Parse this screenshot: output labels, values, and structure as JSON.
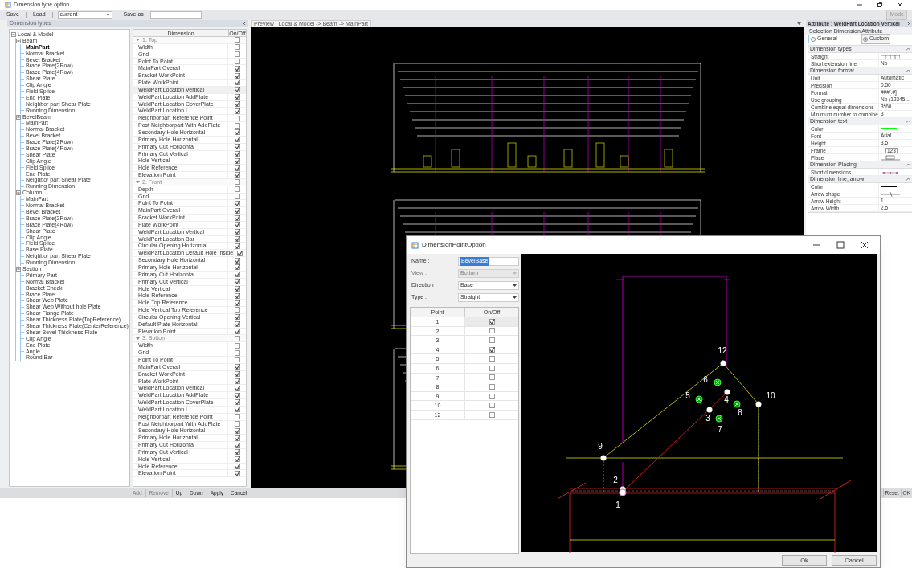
{
  "window": {
    "title": "Dimension type option"
  },
  "toolbar": {
    "save": "Save",
    "load": "Load",
    "preset": "current",
    "save_as": "Save as",
    "mode": "Mode"
  },
  "tree": {
    "title": "Dimension types",
    "root": {
      "label": "Local & Model",
      "expanded": true,
      "children": [
        {
          "label": "Beam",
          "expanded": true,
          "children": [
            {
              "label": "MainPart",
              "selected": true
            },
            {
              "label": "Normal Bracket",
              "selected": false
            },
            {
              "label": "Bevel Bracket",
              "selected": false
            },
            {
              "label": "Brace Plate(2Row)",
              "selected": false
            },
            {
              "label": "Brace Plate(4Row)",
              "selected": false
            },
            {
              "label": "Shear Plate",
              "selected": false
            },
            {
              "label": "Clip Angle",
              "selected": false
            },
            {
              "label": "Field Splice",
              "selected": false
            },
            {
              "label": "End Plate",
              "selected": false
            },
            {
              "label": "Neighbor part Shear Plate",
              "selected": false
            },
            {
              "label": "Running Dimension",
              "selected": false
            }
          ]
        },
        {
          "label": "BevelBeam",
          "expanded": true,
          "children": [
            {
              "label": "MainPart",
              "selected": false
            },
            {
              "label": "Normal Bracket",
              "selected": false
            },
            {
              "label": "Bevel Bracket",
              "selected": false
            },
            {
              "label": "Brace Plate(2Row)",
              "selected": false
            },
            {
              "label": "Brace Plate(4Row)",
              "selected": false
            },
            {
              "label": "Shear Plate",
              "selected": false
            },
            {
              "label": "Clip Angle",
              "selected": false
            },
            {
              "label": "Field Splice",
              "selected": false
            },
            {
              "label": "End Plate",
              "selected": false
            },
            {
              "label": "Neighbor part Shear Plate",
              "selected": false
            },
            {
              "label": "Running Dimension",
              "selected": false
            }
          ]
        },
        {
          "label": "Column",
          "expanded": true,
          "children": [
            {
              "label": "MainPart",
              "selected": false
            },
            {
              "label": "Normal Bracket",
              "selected": false
            },
            {
              "label": "Bevel Bracket",
              "selected": false
            },
            {
              "label": "Brace Plate(2Row)",
              "selected": false
            },
            {
              "label": "Brace Plate(4Row)",
              "selected": false
            },
            {
              "label": "Shear Plate",
              "selected": false
            },
            {
              "label": "Clip Angle",
              "selected": false
            },
            {
              "label": "Field Splice",
              "selected": false
            },
            {
              "label": "Base Plate",
              "selected": false
            },
            {
              "label": "Neighbor part Shear Plate",
              "selected": false
            },
            {
              "label": "Running Dimension",
              "selected": false
            }
          ]
        },
        {
          "label": "Section",
          "expanded": true,
          "children": [
            {
              "label": "Primary Part",
              "selected": false
            },
            {
              "label": "Normal Bracket",
              "selected": false
            },
            {
              "label": "Bracket Check",
              "selected": false
            },
            {
              "label": "Brace Plate",
              "selected": false
            },
            {
              "label": "Shear Web Plate",
              "selected": false
            },
            {
              "label": "Shear Web Without hole Plate",
              "selected": false
            },
            {
              "label": "Shear Flange Plate",
              "selected": false
            },
            {
              "label": "Shear Thickness Plate(TopReference)",
              "selected": false
            },
            {
              "label": "Shear Thickness Plate(CenterReference)",
              "selected": false
            },
            {
              "label": "Shear Bevel Thickness Plate",
              "selected": false
            },
            {
              "label": "Clip Angle",
              "selected": false
            },
            {
              "label": "End Plate",
              "selected": false
            },
            {
              "label": "Angle",
              "selected": false
            },
            {
              "label": "Round Bar",
              "selected": false
            }
          ]
        }
      ]
    }
  },
  "grid": {
    "columns": [
      "Dimension",
      "On/Off"
    ],
    "sections": [
      {
        "label": "1. Top",
        "expanded": true,
        "on": false,
        "rows": [
          {
            "label": "Width",
            "on": false,
            "selected": false
          },
          {
            "label": "Grid",
            "on": false,
            "selected": false
          },
          {
            "label": "Point To Point",
            "on": false,
            "selected": false
          },
          {
            "label": "MainPart Overall",
            "on": true,
            "selected": false
          },
          {
            "label": "Bracket WorkPoint",
            "on": true,
            "selected": false
          },
          {
            "label": "Plate WorkPoint",
            "on": true,
            "selected": false
          },
          {
            "label": "WeldPart Location Vertical",
            "on": true,
            "selected": true
          },
          {
            "label": "WeldPart Location AddPlate",
            "on": true,
            "selected": false
          },
          {
            "label": "WeldPart Location CoverPlate",
            "on": true,
            "selected": false
          },
          {
            "label": "WeldPart Location L",
            "on": true,
            "selected": false
          },
          {
            "label": "Neighborpart Reference Point",
            "on": false,
            "selected": false
          },
          {
            "label": "Post Neighborpart With AddPlate",
            "on": false,
            "selected": false
          },
          {
            "label": "Secondary Hole Horizontal",
            "on": true,
            "selected": false
          },
          {
            "label": "Primary Hole Horizontal",
            "on": true,
            "selected": false
          },
          {
            "label": "Primary Cut Horizontal",
            "on": true,
            "selected": false
          },
          {
            "label": "Primary Cut Vertical",
            "on": true,
            "selected": false
          },
          {
            "label": "Hole Vertical",
            "on": true,
            "selected": false
          },
          {
            "label": "Hole Reference",
            "on": true,
            "selected": false
          },
          {
            "label": "Elevation Point",
            "on": true,
            "selected": false
          }
        ]
      },
      {
        "label": "2. Front",
        "expanded": true,
        "on": false,
        "rows": [
          {
            "label": "Depth",
            "on": false,
            "selected": false
          },
          {
            "label": "Grid",
            "on": false,
            "selected": false
          },
          {
            "label": "Point To Point",
            "on": true,
            "selected": false
          },
          {
            "label": "MainPart Overall",
            "on": true,
            "selected": false
          },
          {
            "label": "Bracket WorkPoint",
            "on": true,
            "selected": false
          },
          {
            "label": "Plate WorkPoint",
            "on": true,
            "selected": false
          },
          {
            "label": "WeldPart Location Vertical",
            "on": true,
            "selected": false
          },
          {
            "label": "WeldPart Location Bar",
            "on": true,
            "selected": false
          },
          {
            "label": "Circular Opening Horizontal",
            "on": true,
            "selected": false
          },
          {
            "label": "WeldPart Location Default Hole Inside",
            "on": true,
            "selected": false
          },
          {
            "label": "Secondary Hole Horizontal",
            "on": true,
            "selected": false
          },
          {
            "label": "Primary Hole Horizontal",
            "on": true,
            "selected": false
          },
          {
            "label": "Primary Cut Horizontal",
            "on": true,
            "selected": false
          },
          {
            "label": "Primary Cut Vertical",
            "on": true,
            "selected": false
          },
          {
            "label": "Hole Vertical",
            "on": true,
            "selected": false
          },
          {
            "label": "Hole Reference",
            "on": true,
            "selected": false
          },
          {
            "label": "Hole Top Reference",
            "on": true,
            "selected": false
          },
          {
            "label": "Hole Vertical Top Reference",
            "on": false,
            "selected": false
          },
          {
            "label": "Circular Opening Vertical",
            "on": true,
            "selected": false
          },
          {
            "label": "Default Plate Horizontal",
            "on": true,
            "selected": false
          },
          {
            "label": "Elevation Point",
            "on": true,
            "selected": false
          }
        ]
      },
      {
        "label": "3. Bottom",
        "expanded": true,
        "on": false,
        "rows": [
          {
            "label": "Width",
            "on": false,
            "selected": false
          },
          {
            "label": "Grid",
            "on": false,
            "selected": false
          },
          {
            "label": "Point To Point",
            "on": false,
            "selected": false
          },
          {
            "label": "MainPart Overall",
            "on": true,
            "selected": false
          },
          {
            "label": "Bracket WorkPoint",
            "on": true,
            "selected": false
          },
          {
            "label": "Plate WorkPoint",
            "on": true,
            "selected": false
          },
          {
            "label": "WeldPart Location Vertical",
            "on": true,
            "selected": false
          },
          {
            "label": "WeldPart Location AddPlate",
            "on": true,
            "selected": false
          },
          {
            "label": "WeldPart Location CoverPlate",
            "on": true,
            "selected": false
          },
          {
            "label": "WeldPart Location L",
            "on": true,
            "selected": false
          },
          {
            "label": "Neighborpart Reference Point",
            "on": false,
            "selected": false
          },
          {
            "label": "Post Neighborpart With AddPlate",
            "on": false,
            "selected": false
          },
          {
            "label": "Secondary Hole Horizontal",
            "on": true,
            "selected": false
          },
          {
            "label": "Primary Hole Horizontal",
            "on": true,
            "selected": false
          },
          {
            "label": "Primary Cut Horizontal",
            "on": true,
            "selected": false
          },
          {
            "label": "Primary Cut Vertical",
            "on": true,
            "selected": false
          },
          {
            "label": "Hole Vertical",
            "on": true,
            "selected": false
          },
          {
            "label": "Hole Reference",
            "on": true,
            "selected": false
          },
          {
            "label": "Elevation Point",
            "on": true,
            "selected": false
          }
        ]
      }
    ]
  },
  "left_buttons": [
    {
      "label": "Add",
      "disabled": true
    },
    {
      "label": "Remove",
      "disabled": true
    },
    {
      "label": "Up",
      "disabled": false
    },
    {
      "label": "Down",
      "disabled": false
    },
    {
      "label": "Apply",
      "disabled": false
    },
    {
      "label": "Cancel",
      "disabled": false
    }
  ],
  "preview": {
    "title": "Preview : Local & Model -> Beam -> MainPart"
  },
  "attribute": {
    "title": "Attribute : WeldPart Location Vertical",
    "subtitle": "Selection Dimension Attribute",
    "modes": [
      {
        "label": "General",
        "selected": false
      },
      {
        "label": "Custom",
        "selected": true
      }
    ],
    "groups": [
      {
        "label": "Dimension types",
        "expanded": true,
        "rows": [
          {
            "label": "Straight",
            "kind": "straight"
          },
          {
            "label": "Short extension line",
            "kind": "text",
            "value": "No"
          }
        ]
      },
      {
        "label": "Dimension format",
        "expanded": true,
        "rows": [
          {
            "label": "Unit",
            "kind": "text",
            "value": "Automatic"
          },
          {
            "label": "Precision",
            "kind": "text",
            "value": "0.50"
          },
          {
            "label": "Format",
            "kind": "text",
            "value": "###[.#]"
          },
          {
            "label": "Use grouping",
            "kind": "text",
            "value": "No (12345..."
          },
          {
            "label": "Combine equal dimensions",
            "kind": "text",
            "value": "3*60"
          },
          {
            "label": "Minimum number to combine",
            "kind": "text",
            "value": "3"
          }
        ]
      },
      {
        "label": "Dimension text",
        "expanded": true,
        "rows": [
          {
            "label": "Color",
            "kind": "color",
            "color": "#00ff00"
          },
          {
            "label": "Font",
            "kind": "text",
            "value": "Arial"
          },
          {
            "label": "Height",
            "kind": "text",
            "value": "3.5"
          },
          {
            "label": "Frame",
            "kind": "framed",
            "value": "123"
          },
          {
            "label": "Place",
            "kind": "place"
          }
        ]
      },
      {
        "label": "Dimension Placing",
        "expanded": true,
        "rows": [
          {
            "label": "Short dimensions",
            "kind": "short"
          }
        ]
      },
      {
        "label": "Dimension line, arrow",
        "expanded": true,
        "rows": [
          {
            "label": "Color",
            "kind": "color",
            "color": "#000000"
          },
          {
            "label": "Arrow shape",
            "kind": "arrow"
          },
          {
            "label": "Arrow Height",
            "kind": "text",
            "value": "1"
          },
          {
            "label": "Arrow Width",
            "kind": "text",
            "value": "2.5"
          }
        ]
      }
    ]
  },
  "right_buttons": [
    "Reset",
    "OK"
  ],
  "dialog": {
    "title": "DimensionPointOption",
    "fields": [
      {
        "label": "Name :",
        "value": "BevelBase",
        "kind": "text",
        "disabled": false
      },
      {
        "label": "View :",
        "value": "Bottom",
        "kind": "dropdown",
        "disabled": true
      },
      {
        "label": "Direction :",
        "value": "Base",
        "kind": "dropdown",
        "disabled": false
      },
      {
        "label": "Type :",
        "value": "Straight",
        "kind": "dropdown",
        "disabled": false
      }
    ],
    "columns": [
      "Point",
      "On/Off"
    ],
    "points": [
      {
        "point": "1",
        "on": true,
        "selected": true
      },
      {
        "point": "2",
        "on": false,
        "selected": false
      },
      {
        "point": "3",
        "on": false,
        "selected": false
      },
      {
        "point": "4",
        "on": true,
        "selected": false
      },
      {
        "point": "5",
        "on": false,
        "selected": false
      },
      {
        "point": "6",
        "on": false,
        "selected": false
      },
      {
        "point": "7",
        "on": false,
        "selected": false
      },
      {
        "point": "8",
        "on": false,
        "selected": false
      },
      {
        "point": "9",
        "on": false,
        "selected": false
      },
      {
        "point": "10",
        "on": false,
        "selected": false
      },
      {
        "point": "12",
        "on": false,
        "selected": false
      }
    ],
    "markers": [
      {
        "label": "12",
        "kind": "dot"
      },
      {
        "label": "6",
        "kind": "target"
      },
      {
        "label": "5",
        "kind": "target"
      },
      {
        "label": "4",
        "kind": "dot"
      },
      {
        "label": "10",
        "kind": "dot"
      },
      {
        "label": "8",
        "kind": "target"
      },
      {
        "label": "3",
        "kind": "dot"
      },
      {
        "label": "7",
        "kind": "target"
      },
      {
        "label": "9",
        "kind": "dot"
      },
      {
        "label": "2",
        "kind": "dot"
      },
      {
        "label": "1",
        "kind": "base"
      }
    ],
    "buttons": [
      "Ok",
      "Cancel"
    ]
  }
}
